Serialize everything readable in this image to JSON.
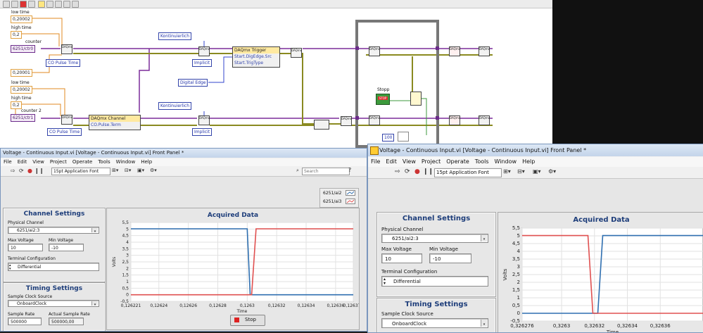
{
  "block_diagram": {
    "low_time_1": "low time",
    "low_time_1_val": "0,20002",
    "high_time_1": "high time",
    "high_time_1_val": "0,2",
    "counter_1": "counter",
    "channel_1": "6251/ctr0",
    "pulse_1": "CO Pulse Time",
    "init_delay_1": "0,20001",
    "low_time_2": "low time",
    "low_time_2_val": "0,20002",
    "high_time_2": "high time",
    "high_time_2_val": "0,2",
    "counter_2": "counter 2",
    "channel_2": "6251/ctr1",
    "pulse_2": "CO Pulse Time",
    "mode_1": "Kontinuierlich",
    "implicit_1": "Implicit",
    "mode_2": "Kontinuierlich",
    "implicit_2": "Implicit",
    "trigger_title": "DAQmx Trigger",
    "trigger_src": "Start.DigEdge.Src",
    "trigger_type": "Start.TrigType",
    "edge": "Digital Edge",
    "channel_node_title": "DAQmx Channel",
    "channel_node_prop": "CO.Pulse.Term",
    "stop_label": "Stopp",
    "stop_button": "STOP",
    "wait_value": "100",
    "vi_label": "DAQmx"
  },
  "left_window": {
    "title": "Voltage - Continuous Input.vi [Voltage - Continuous Input.vi] Front Panel *",
    "menu": [
      "File",
      "Edit",
      "View",
      "Project",
      "Operate",
      "Tools",
      "Window",
      "Help"
    ],
    "font": "15pt Application Font",
    "search_placeholder": "Search",
    "legend": [
      "6251/ai2",
      "6251/ai3"
    ],
    "channel_settings": {
      "title": "Channel Settings",
      "physical_channel_label": "Physical Channel",
      "physical_channel": "6251/ai2:3",
      "max_voltage_label": "Max Voltage",
      "max_voltage": "10",
      "min_voltage_label": "Min Voltage",
      "min_voltage": "-10",
      "terminal_label": "Terminal Configuration",
      "terminal": "Differential"
    },
    "timing_settings": {
      "title": "Timing Settings",
      "clock_source_label": "Sample Clock Source",
      "clock_source": "OnboardClock",
      "rate_label": "Sample Rate",
      "rate": "500000",
      "actual_rate_label": "Actual Sample Rate",
      "actual_rate": "500000,00"
    },
    "stop": "Stop"
  },
  "right_window": {
    "title": "Voltage - Continuous Input.vi [Voltage - Continuous Input.vi] Front Panel *",
    "menu": [
      "File",
      "Edit",
      "View",
      "Project",
      "Operate",
      "Tools",
      "Window",
      "Help"
    ],
    "font": "15pt Application Font",
    "channel_settings": {
      "title": "Channel Settings",
      "physical_channel_label": "Physical Channel",
      "physical_channel": "6251/ai2:3",
      "max_voltage_label": "Max Voltage",
      "max_voltage": "10",
      "min_voltage_label": "Min Voltage",
      "min_voltage": "-10",
      "terminal_label": "Terminal Configuration",
      "terminal": "Differential"
    },
    "timing_settings": {
      "title": "Timing Settings",
      "clock_source_label": "Sample Clock Source",
      "clock_source": "OnboardClock"
    }
  },
  "chart_data": [
    {
      "type": "line",
      "title": "Acquired Data",
      "xlabel": "Time",
      "ylabel": "Volts",
      "xlim": [
        0.126221,
        0.126372
      ],
      "ylim": [
        -0.5,
        5.5
      ],
      "xticks": [
        "0,126221",
        "0,12624",
        "0,12626",
        "0,12628",
        "0,1263",
        "0,12632",
        "0,12634",
        "0,12636",
        "0,126372"
      ],
      "yticks": [
        "5,5",
        "5",
        "4,5",
        "4",
        "3,5",
        "3",
        "2,5",
        "2",
        "1,5",
        "1",
        "0,5",
        "0",
        "-0,5"
      ],
      "grid": true,
      "series": [
        {
          "name": "6251/ai2",
          "color": "#2f6fb0",
          "x": [
            0.126221,
            0.1263,
            0.126302,
            0.126372
          ],
          "y": [
            5.02,
            5.02,
            0,
            0
          ]
        },
        {
          "name": "6251/ai3",
          "color": "#e05050",
          "x": [
            0.126221,
            0.126303,
            0.126306,
            0.126372
          ],
          "y": [
            0,
            0,
            5.02,
            5.02
          ]
        }
      ]
    },
    {
      "type": "line",
      "title": "Acquired Data",
      "xlabel": "Time",
      "ylabel": "Volts",
      "xlim": [
        0.326276,
        0.326386
      ],
      "ylim": [
        -0.5,
        5.5
      ],
      "xticks": [
        "0,326276",
        "0,3263",
        "0,32632",
        "0,32634",
        "0,32636"
      ],
      "yticks": [
        "5,5",
        "5",
        "4,5",
        "4",
        "3,5",
        "3",
        "2,5",
        "2",
        "1,5",
        "1",
        "0,5",
        "0",
        "-0,5"
      ],
      "grid": true,
      "series": [
        {
          "name": "6251/ai2",
          "color": "#2f6fb0",
          "x": [
            0.326276,
            0.326322,
            0.326325,
            0.326386
          ],
          "y": [
            0,
            0,
            5.02,
            5.02
          ]
        },
        {
          "name": "6251/ai3",
          "color": "#e05050",
          "x": [
            0.326276,
            0.326316,
            0.326319,
            0.326386
          ],
          "y": [
            5.02,
            5.02,
            0,
            0
          ]
        }
      ]
    }
  ]
}
